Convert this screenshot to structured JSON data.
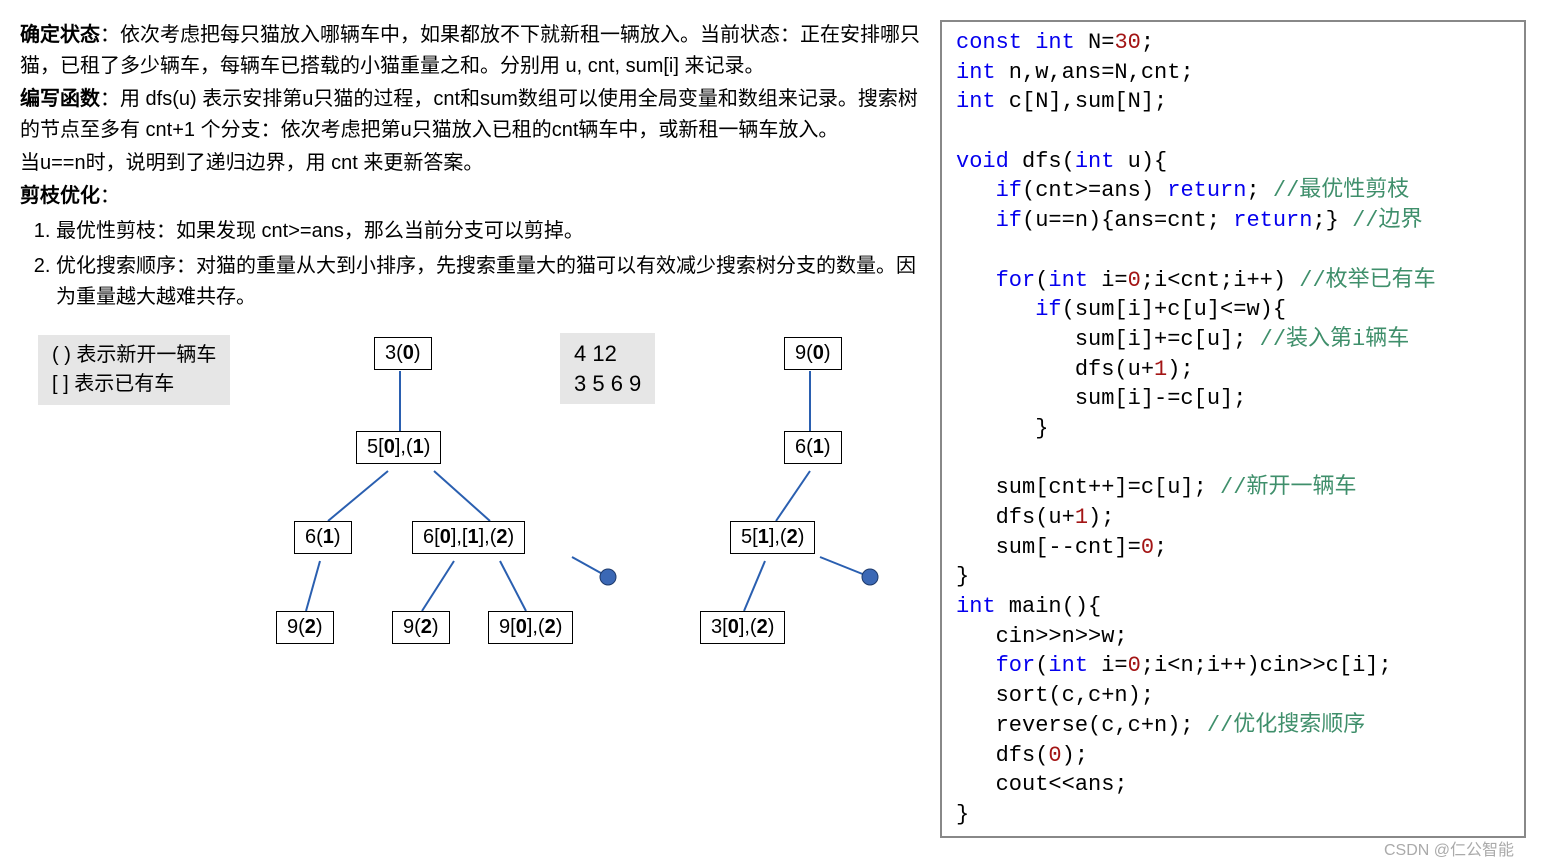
{
  "text": {
    "p1_bold": "确定状态",
    "p1": "：依次考虑把每只猫放入哪辆车中，如果都放不下就新租一辆放入。当前状态：正在安排哪只猫，已租了多少辆车，每辆车已搭载的小猫重量之和。分别用 u, cnt, sum[i] 来记录。",
    "p2_bold": "编写函数",
    "p2": "：用 dfs(u) 表示安排第u只猫的过程，cnt和sum数组可以使用全局变量和数组来记录。搜索树的节点至多有 cnt+1 个分支：依次考虑把第u只猫放入已租的cnt辆车中，或新租一辆车放入。",
    "p2b": "当u==n时，说明到了递归边界，用 cnt 来更新答案。",
    "p3_bold": "剪枝优化",
    "p3_colon": "：",
    "li1": "最优性剪枝：如果发现 cnt>=ans，那么当前分支可以剪掉。",
    "li2": "优化搜索顺序：对猫的重量从大到小排序，先搜索重量大的猫可以有效减少搜索树分支的数量。因为重量越大越难共存。",
    "legend1": "( ) 表示新开一辆车",
    "legend2": "[ ] 表示已有车",
    "input_box": "4 12\n3 5 6 9"
  },
  "tree_left": {
    "n1": {
      "pre": "3(",
      "b": "0",
      "post": ")"
    },
    "n2": {
      "pre": "5[",
      "b": "0",
      "mid": "],(",
      "b2": "1",
      "post": ")"
    },
    "n3": {
      "pre": "6(",
      "b": "1",
      "post": ")"
    },
    "n4": {
      "pre": "6[",
      "b": "0",
      "mid": "],[",
      "b2": "1",
      "mid2": "],(",
      "b3": "2",
      "post": ")"
    },
    "n5": {
      "pre": "9(",
      "b": "2",
      "post": ")"
    },
    "n6": {
      "pre": "9(",
      "b": "2",
      "post": ")"
    },
    "n7": {
      "pre": "9[",
      "b": "0",
      "mid": "],(",
      "b2": "2",
      "post": ")"
    }
  },
  "tree_right": {
    "n1": {
      "pre": "9(",
      "b": "0",
      "post": ")"
    },
    "n2": {
      "pre": "6(",
      "b": "1",
      "post": ")"
    },
    "n3": {
      "pre": "5[",
      "b": "1",
      "mid": "],(",
      "b2": "2",
      "post": ")"
    },
    "n4": {
      "pre": "3[",
      "b": "0",
      "mid": "],(",
      "b2": "2",
      "post": ")"
    }
  },
  "code": {
    "l1a": "const int",
    "l1b": " N=",
    "l1c": "30",
    "l1d": ";",
    "l2a": "int",
    "l2b": " n,w,ans=N,cnt;",
    "l3a": "int",
    "l3b": " c[N],sum[N];",
    "blank": "",
    "l4a": "void",
    "l4b": " dfs(",
    "l4c": "int",
    "l4d": " u){",
    "l5a": "   ",
    "l5b": "if",
    "l5c": "(cnt>=ans) ",
    "l5d": "return",
    "l5e": "; ",
    "l5f": "//最优性剪枝",
    "l6a": "   ",
    "l6b": "if",
    "l6c": "(u==n){ans=cnt; ",
    "l6d": "return",
    "l6e": ";} ",
    "l6f": "//边界",
    "l7a": "   ",
    "l7b": "for",
    "l7c": "(",
    "l7d": "int",
    "l7e": " i=",
    "l7f": "0",
    "l7g": ";i<cnt;i++) ",
    "l7h": "//枚举已有车",
    "l8a": "      ",
    "l8b": "if",
    "l8c": "(sum[i]+c[u]<=w){",
    "l9a": "         sum[i]+=c[u]; ",
    "l9b": "//装入第i辆车",
    "l10": "         dfs(u+",
    "l10b": "1",
    "l10c": ");",
    "l11": "         sum[i]-=c[u];",
    "l12": "      }",
    "l13a": "   sum[cnt++]=c[u]; ",
    "l13b": "//新开一辆车",
    "l14": "   dfs(u+",
    "l14b": "1",
    "l14c": ");",
    "l15": "   sum[--cnt]=",
    "l15b": "0",
    "l15c": ";",
    "l16": "}",
    "l17a": "int",
    "l17b": " main(){",
    "l18": "   cin>>n>>w;",
    "l19a": "   ",
    "l19b": "for",
    "l19c": "(",
    "l19d": "int",
    "l19e": " i=",
    "l19f": "0",
    "l19g": ";i<n;i++)cin>>c[i];",
    "l20": "   sort(c,c+n);",
    "l21a": "   reverse(c,c+n); ",
    "l21b": "//优化搜索顺序",
    "l22": "   dfs(",
    "l22b": "0",
    "l22c": ");",
    "l23": "   cout<<ans;",
    "l24": "}"
  },
  "credit": "CSDN @仁公智能"
}
